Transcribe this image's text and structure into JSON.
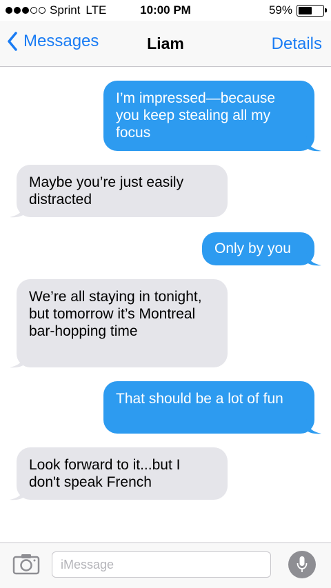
{
  "status_bar": {
    "carrier": "Sprint",
    "network": "LTE",
    "time": "10:00 PM",
    "battery_label": "59%",
    "battery_level": 0.59,
    "signal_bars_filled": 3,
    "signal_bars_total": 5
  },
  "nav": {
    "back_label": "Messages",
    "title": "Liam",
    "details_label": "Details"
  },
  "messages": [
    {
      "direction": "sent",
      "text": "I’m impressed—because you keep stealing all my focus"
    },
    {
      "direction": "received",
      "text": "Maybe you’re just easily distracted"
    },
    {
      "direction": "sent",
      "text": "Only by you"
    },
    {
      "direction": "received",
      "text": "We’re all staying in tonight, but tomorrow it’s Montreal bar-hopping time"
    },
    {
      "direction": "sent",
      "text": "That should be a lot of fun"
    },
    {
      "direction": "received",
      "text": "Look forward to it...but I don't speak French"
    }
  ],
  "input": {
    "placeholder": "iMessage",
    "value": ""
  },
  "icons": {
    "back": "chevron-left-icon",
    "camera": "camera-icon",
    "mic": "microphone-icon"
  },
  "colors": {
    "accent": "#1a7cf4",
    "sent_bubble": "#2d9bf0",
    "received_bubble": "#e5e5ea"
  }
}
